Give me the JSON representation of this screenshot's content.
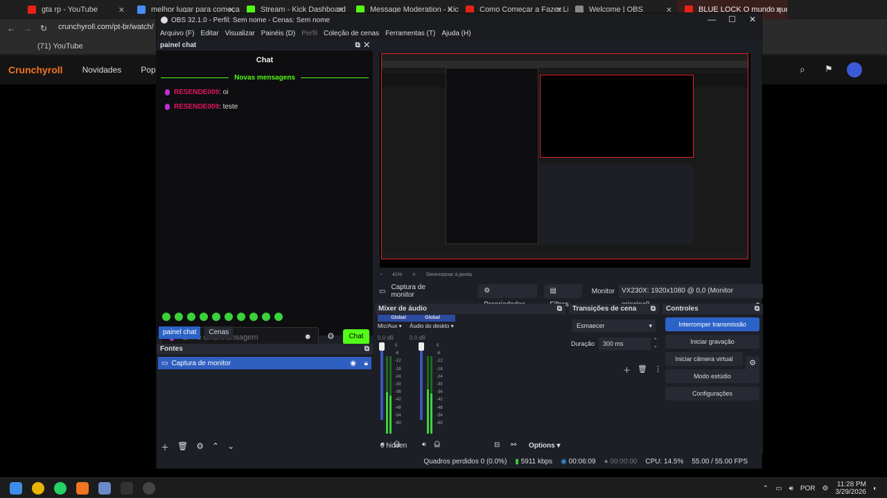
{
  "chrome": {
    "tabs": [
      {
        "title": "gta rp - YouTube",
        "color": "#e62117"
      },
      {
        "title": "melhor lugar para começar a f...",
        "color": "#4a8cf7"
      },
      {
        "title": "Stream - Kick Dashboard",
        "color": "#53fc18"
      },
      {
        "title": "Message Moderation - Kick Da...",
        "color": "#53fc18"
      },
      {
        "title": "Como Começar a Fazer Live na...",
        "color": "#e62117"
      },
      {
        "title": "Welcome | OBS",
        "color": "#888888"
      },
      {
        "title": "BLUE LOCK O mundo que...",
        "color": "#e62117"
      }
    ],
    "url": "crunchyroll.com/pt-br/watch/",
    "bookmark": "(71) YouTube"
  },
  "crunchyroll": {
    "logo": "Crunchyroll",
    "nav": [
      "Novidades",
      "Popu"
    ]
  },
  "obs": {
    "title": "OBS 32.1.0 - Perfil: Sem nome - Cenas: Sem nome",
    "menu": [
      "Arquivo (F)",
      "Editar",
      "Visualizar",
      "Painéis (D)",
      "Perfil",
      "Coleção de cenas",
      "Ferramentas (T)",
      "Ajuda (H)"
    ],
    "chat_dock": {
      "dock_title": "painel chat",
      "header": "Chat",
      "new_messages": "Novas mensagens",
      "messages": [
        {
          "user": "RESENDE009",
          "text": ": oi"
        },
        {
          "user": "RESENDE009",
          "text": ": teste"
        }
      ],
      "input_placeholder": "Envie uma mensagem",
      "send_label": "Chat"
    },
    "dock_tabs": [
      "painel chat",
      "Cenas"
    ],
    "sources": {
      "title": "Fontes",
      "items": [
        "Captura de monitor"
      ]
    },
    "preview": {
      "zoom": "41%",
      "resize_label": "Dimensionar à janela"
    },
    "capture_bar": {
      "source_name": "Captura de monitor",
      "properties": "Propriedades",
      "filters": "Filtros",
      "monitor_label": "Monitor",
      "monitor_value": "VX230X: 1920x1080 @ 0,0 (Monitor principal)"
    },
    "mixer": {
      "title": "Mixer de áudio",
      "channels": [
        {
          "global": "Global",
          "name": "Mic/Aux",
          "db": "0.0 dB"
        },
        {
          "global": "Global",
          "name": "Áudio do deskto",
          "db": "0.0 dB"
        }
      ],
      "scale": [
        "0",
        "-6",
        "-12",
        "-18",
        "-24",
        "-30",
        "-36",
        "-42",
        "-48",
        "-54",
        "-60"
      ],
      "hidden": "0 hidden",
      "options": "Options"
    },
    "transitions": {
      "title": "Transições de cena",
      "selected": "Esmaecer",
      "duration_label": "Duração",
      "duration_value": "300 ms"
    },
    "controls": {
      "title": "Controles",
      "buttons": [
        "Interromper transmissão",
        "Iniciar gravação",
        "Iniciar câmera virtual",
        "Modo estúdio",
        "Configurações"
      ]
    },
    "status": {
      "frames": "Quadros perdidos 0 (0.0%)",
      "bitrate": "5911 kbps",
      "stream_time": "00:06:09",
      "rec_time": "00:00:00",
      "cpu": "CPU: 14.5%",
      "fps": "55.00 / 55.00 FPS"
    }
  },
  "taskbar": {
    "lang": "POR",
    "time": "11:28 PM",
    "date": "3/29/2026"
  }
}
